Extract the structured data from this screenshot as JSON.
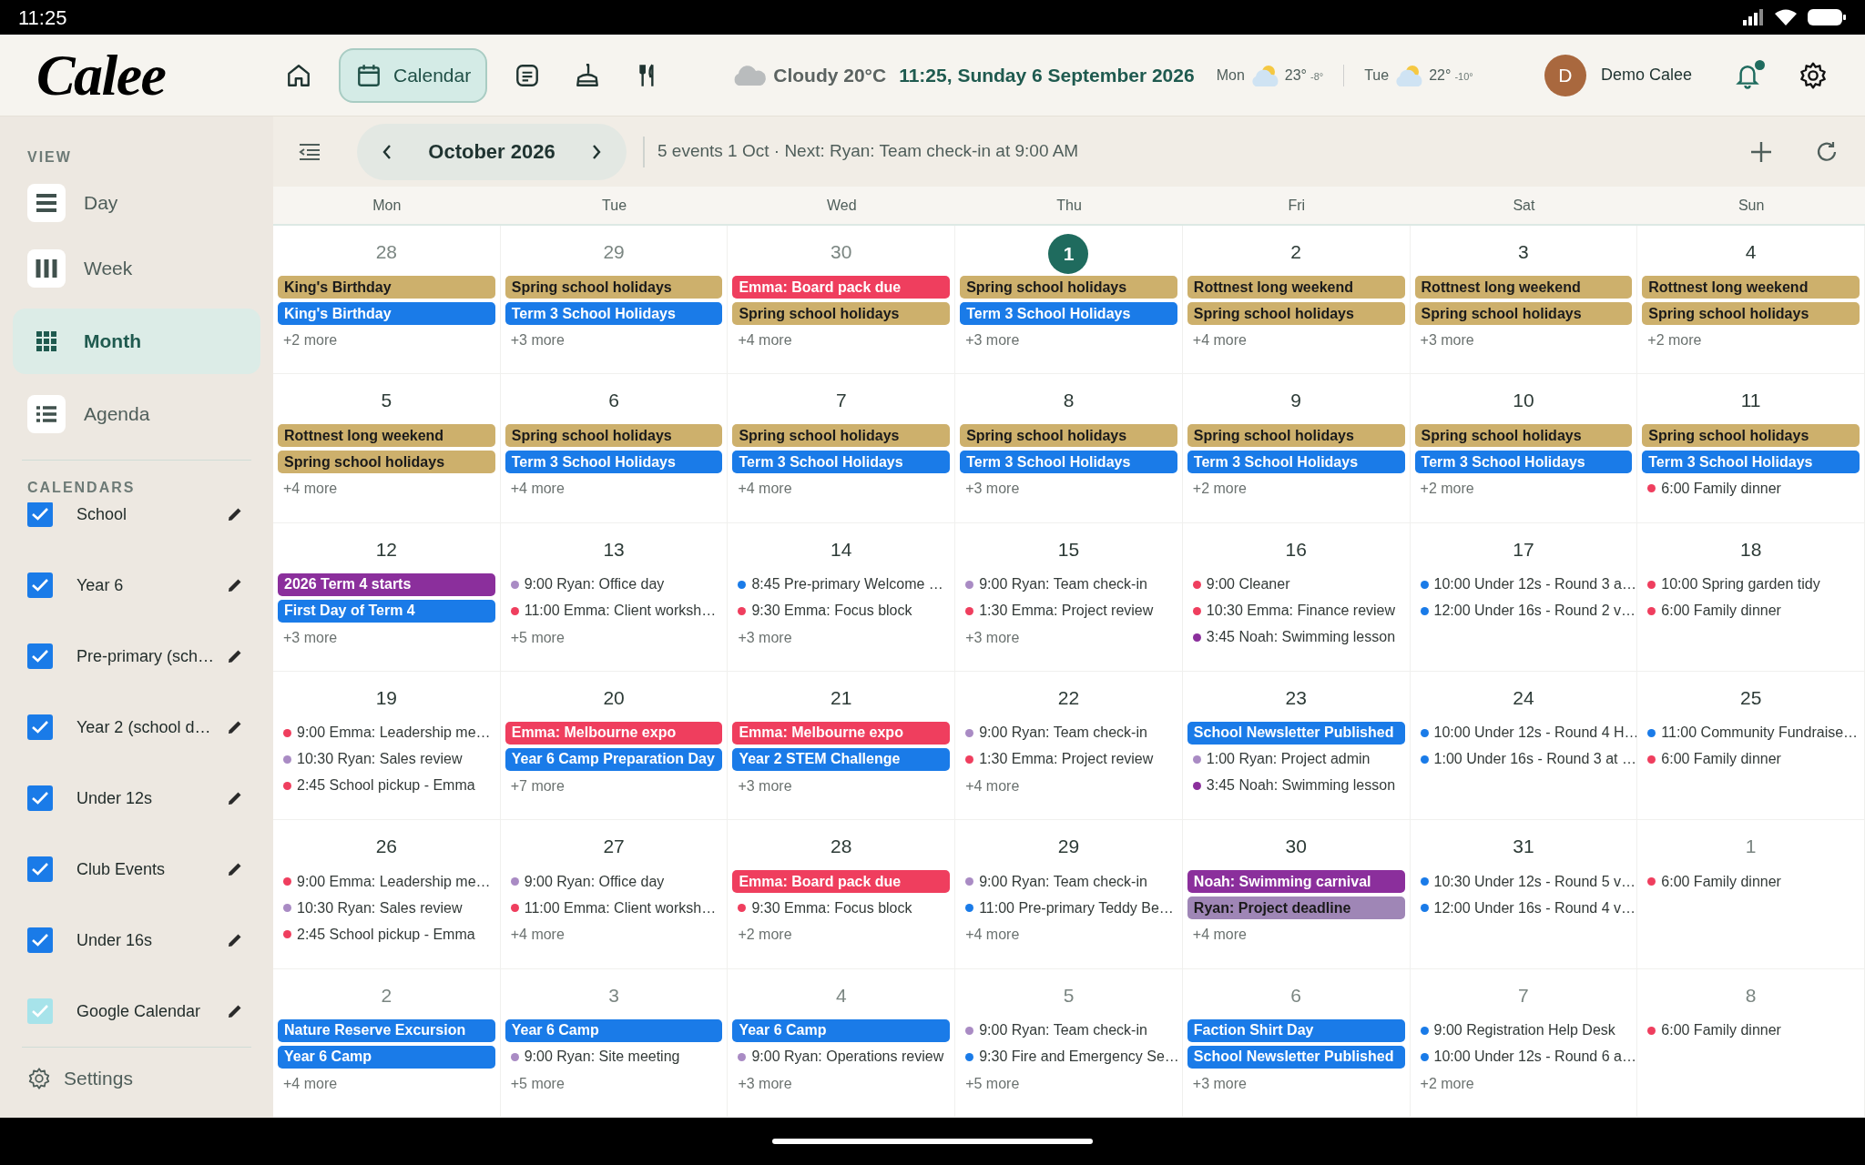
{
  "status_bar": {
    "time": "11:25"
  },
  "header": {
    "logo": "Calee",
    "nav": [
      {
        "selected": false
      },
      {
        "label": "Calendar",
        "selected": true
      },
      {
        "selected": false
      },
      {
        "selected": false
      },
      {
        "selected": false
      }
    ],
    "weather": {
      "now": "Cloudy 20°C",
      "datetime": "11:25, Sunday 6 September 2026",
      "forecast": [
        {
          "day": "Mon",
          "high": "23°",
          "low": "-8°"
        },
        {
          "day": "Tue",
          "high": "22°",
          "low": "-10°"
        }
      ]
    },
    "user": {
      "initial": "D",
      "name": "Demo Calee"
    },
    "notifications_unread": true
  },
  "sidebar": {
    "view_heading": "VIEW",
    "views": [
      {
        "label": "Day",
        "selected": false
      },
      {
        "label": "Week",
        "selected": false
      },
      {
        "label": "Month",
        "selected": true
      },
      {
        "label": "Agenda",
        "selected": false
      }
    ],
    "calendars_heading": "CALENDARS",
    "calendars": [
      {
        "label": "School",
        "checked": true,
        "color": "#1a7be8"
      },
      {
        "label": "Year 6",
        "checked": true,
        "color": "#1a7be8"
      },
      {
        "label": "Pre-primary (sch…",
        "checked": true,
        "color": "#1a7be8"
      },
      {
        "label": "Year 2 (school d…",
        "checked": true,
        "color": "#1a7be8"
      },
      {
        "label": "Under 12s",
        "checked": true,
        "color": "#1a7be8"
      },
      {
        "label": "Club Events",
        "checked": true,
        "color": "#1a7be8"
      },
      {
        "label": "Under 16s",
        "checked": true,
        "color": "#1a7be8"
      },
      {
        "label": "Google Calendar",
        "checked": true,
        "color": "#a7e3ea"
      }
    ],
    "settings": "Settings"
  },
  "toolbar": {
    "month": "October 2026",
    "summary": "5 events 1 Oct · Next: Ryan: Team check-in at 9:00 AM"
  },
  "weekdays": [
    "Mon",
    "Tue",
    "Wed",
    "Thu",
    "Fri",
    "Sat",
    "Sun"
  ],
  "weeks": [
    [
      {
        "day": "28",
        "in_month": false,
        "today": false,
        "events": [
          {
            "kind": "bar",
            "title": "King's Birthday",
            "color": "#cdb06c"
          },
          {
            "kind": "bar",
            "title": "King's Birthday",
            "color": "#1a7be8"
          }
        ],
        "more": "+2 more"
      },
      {
        "day": "29",
        "in_month": false,
        "today": false,
        "events": [
          {
            "kind": "bar",
            "title": "Spring school holidays",
            "color": "#cdb06c"
          },
          {
            "kind": "bar",
            "title": "Term 3 School Holidays",
            "color": "#1a7be8"
          }
        ],
        "more": "+3 more"
      },
      {
        "day": "30",
        "in_month": false,
        "today": false,
        "events": [
          {
            "kind": "bar",
            "title": "Emma: Board pack due",
            "color": "#ef3e5e"
          },
          {
            "kind": "bar",
            "title": "Spring school holidays",
            "color": "#cdb06c"
          }
        ],
        "more": "+4 more"
      },
      {
        "day": "1",
        "in_month": true,
        "today": true,
        "events": [
          {
            "kind": "bar",
            "title": "Spring school holidays",
            "color": "#cdb06c"
          },
          {
            "kind": "bar",
            "title": "Term 3 School Holidays",
            "color": "#1a7be8"
          }
        ],
        "more": "+3 more"
      },
      {
        "day": "2",
        "in_month": true,
        "today": false,
        "events": [
          {
            "kind": "bar",
            "title": "Rottnest long weekend",
            "color": "#cdb06c"
          },
          {
            "kind": "bar",
            "title": "Spring school holidays",
            "color": "#cdb06c"
          }
        ],
        "more": "+4 more"
      },
      {
        "day": "3",
        "in_month": true,
        "today": false,
        "events": [
          {
            "kind": "bar",
            "title": "Rottnest long weekend",
            "color": "#cdb06c"
          },
          {
            "kind": "bar",
            "title": "Spring school holidays",
            "color": "#cdb06c"
          }
        ],
        "more": "+3 more"
      },
      {
        "day": "4",
        "in_month": true,
        "today": false,
        "events": [
          {
            "kind": "bar",
            "title": "Rottnest long weekend",
            "color": "#cdb06c"
          },
          {
            "kind": "bar",
            "title": "Spring school holidays",
            "color": "#cdb06c"
          }
        ],
        "more": "+2 more"
      }
    ],
    [
      {
        "day": "5",
        "in_month": true,
        "today": false,
        "events": [
          {
            "kind": "bar",
            "title": "Rottnest long weekend",
            "color": "#cdb06c"
          },
          {
            "kind": "bar",
            "title": "Spring school holidays",
            "color": "#cdb06c"
          }
        ],
        "more": "+4 more"
      },
      {
        "day": "6",
        "in_month": true,
        "today": false,
        "events": [
          {
            "kind": "bar",
            "title": "Spring school holidays",
            "color": "#cdb06c"
          },
          {
            "kind": "bar",
            "title": "Term 3 School Holidays",
            "color": "#1a7be8"
          }
        ],
        "more": "+4 more"
      },
      {
        "day": "7",
        "in_month": true,
        "today": false,
        "events": [
          {
            "kind": "bar",
            "title": "Spring school holidays",
            "color": "#cdb06c"
          },
          {
            "kind": "bar",
            "title": "Term 3 School Holidays",
            "color": "#1a7be8"
          }
        ],
        "more": "+4 more"
      },
      {
        "day": "8",
        "in_month": true,
        "today": false,
        "events": [
          {
            "kind": "bar",
            "title": "Spring school holidays",
            "color": "#cdb06c"
          },
          {
            "kind": "bar",
            "title": "Term 3 School Holidays",
            "color": "#1a7be8"
          }
        ],
        "more": "+3 more"
      },
      {
        "day": "9",
        "in_month": true,
        "today": false,
        "events": [
          {
            "kind": "bar",
            "title": "Spring school holidays",
            "color": "#cdb06c"
          },
          {
            "kind": "bar",
            "title": "Term 3 School Holidays",
            "color": "#1a7be8"
          }
        ],
        "more": "+2 more"
      },
      {
        "day": "10",
        "in_month": true,
        "today": false,
        "events": [
          {
            "kind": "bar",
            "title": "Spring school holidays",
            "color": "#cdb06c"
          },
          {
            "kind": "bar",
            "title": "Term 3 School Holidays",
            "color": "#1a7be8"
          }
        ],
        "more": "+2 more"
      },
      {
        "day": "11",
        "in_month": true,
        "today": false,
        "events": [
          {
            "kind": "bar",
            "title": "Spring school holidays",
            "color": "#cdb06c"
          },
          {
            "kind": "bar",
            "title": "Term 3 School Holidays",
            "color": "#1a7be8"
          },
          {
            "kind": "dot",
            "title": "6:00 Family dinner",
            "color": "#ef3e5e"
          }
        ]
      }
    ],
    [
      {
        "day": "12",
        "in_month": true,
        "today": false,
        "events": [
          {
            "kind": "bar",
            "title": "2026 Term 4 starts",
            "color": "#8b2f9c"
          },
          {
            "kind": "bar",
            "title": "First Day of Term 4",
            "color": "#1a7be8"
          }
        ],
        "more": "+3 more"
      },
      {
        "day": "13",
        "in_month": true,
        "today": false,
        "events": [
          {
            "kind": "dot",
            "title": "9:00 Ryan: Office day",
            "color": "#a98bc4"
          },
          {
            "kind": "dot",
            "title": "11:00 Emma: Client worksh…",
            "color": "#ef3e5e"
          }
        ],
        "more": "+5 more"
      },
      {
        "day": "14",
        "in_month": true,
        "today": false,
        "events": [
          {
            "kind": "dot",
            "title": "8:45 Pre-primary Welcome …",
            "color": "#1a7be8"
          },
          {
            "kind": "dot",
            "title": "9:30 Emma: Focus block",
            "color": "#ef3e5e"
          }
        ],
        "more": "+3 more"
      },
      {
        "day": "15",
        "in_month": true,
        "today": false,
        "events": [
          {
            "kind": "dot",
            "title": "9:00 Ryan: Team check-in",
            "color": "#a98bc4"
          },
          {
            "kind": "dot",
            "title": "1:30 Emma: Project review",
            "color": "#ef3e5e"
          }
        ],
        "more": "+3 more"
      },
      {
        "day": "16",
        "in_month": true,
        "today": false,
        "events": [
          {
            "kind": "dot",
            "title": "9:00 Cleaner",
            "color": "#ef3e5e"
          },
          {
            "kind": "dot",
            "title": "10:30 Emma: Finance review",
            "color": "#ef3e5e"
          },
          {
            "kind": "dot",
            "title": "3:45 Noah: Swimming lesson",
            "color": "#8b2f9c"
          }
        ]
      },
      {
        "day": "17",
        "in_month": true,
        "today": false,
        "events": [
          {
            "kind": "dot",
            "title": "10:00 Under 12s - Round 3 a…",
            "color": "#1a7be8"
          },
          {
            "kind": "dot",
            "title": "12:00 Under 16s - Round 2 v…",
            "color": "#1a7be8"
          }
        ]
      },
      {
        "day": "18",
        "in_month": true,
        "today": false,
        "events": [
          {
            "kind": "dot",
            "title": "10:00 Spring garden tidy",
            "color": "#ef3e5e"
          },
          {
            "kind": "dot",
            "title": "6:00 Family dinner",
            "color": "#ef3e5e"
          }
        ]
      }
    ],
    [
      {
        "day": "19",
        "in_month": true,
        "today": false,
        "events": [
          {
            "kind": "dot",
            "title": "9:00 Emma: Leadership me…",
            "color": "#ef3e5e"
          },
          {
            "kind": "dot",
            "title": "10:30 Ryan: Sales review",
            "color": "#a98bc4"
          },
          {
            "kind": "dot",
            "title": "2:45 School pickup - Emma",
            "color": "#ef3e5e"
          }
        ]
      },
      {
        "day": "20",
        "in_month": true,
        "today": false,
        "events": [
          {
            "kind": "bar",
            "title": "Emma: Melbourne expo",
            "color": "#ef3e5e"
          },
          {
            "kind": "bar",
            "title": "Year 6 Camp Preparation Day",
            "color": "#1a7be8"
          }
        ],
        "more": "+7 more"
      },
      {
        "day": "21",
        "in_month": true,
        "today": false,
        "events": [
          {
            "kind": "bar",
            "title": "Emma: Melbourne expo",
            "color": "#ef3e5e"
          },
          {
            "kind": "bar",
            "title": "Year 2 STEM Challenge",
            "color": "#1a7be8"
          }
        ],
        "more": "+3 more"
      },
      {
        "day": "22",
        "in_month": true,
        "today": false,
        "events": [
          {
            "kind": "dot",
            "title": "9:00 Ryan: Team check-in",
            "color": "#a98bc4"
          },
          {
            "kind": "dot",
            "title": "1:30 Emma: Project review",
            "color": "#ef3e5e"
          }
        ],
        "more": "+4 more"
      },
      {
        "day": "23",
        "in_month": true,
        "today": false,
        "events": [
          {
            "kind": "bar",
            "title": "School Newsletter Published",
            "color": "#1a7be8"
          },
          {
            "kind": "dot",
            "title": "1:00 Ryan: Project admin",
            "color": "#a98bc4"
          },
          {
            "kind": "dot",
            "title": "3:45 Noah: Swimming lesson",
            "color": "#8b2f9c"
          }
        ]
      },
      {
        "day": "24",
        "in_month": true,
        "today": false,
        "events": [
          {
            "kind": "dot",
            "title": "10:00 Under 12s - Round 4 H…",
            "color": "#1a7be8"
          },
          {
            "kind": "dot",
            "title": "1:00 Under 16s - Round 3 at …",
            "color": "#1a7be8"
          }
        ]
      },
      {
        "day": "25",
        "in_month": true,
        "today": false,
        "events": [
          {
            "kind": "dot",
            "title": "11:00 Community Fundraise…",
            "color": "#1a7be8"
          },
          {
            "kind": "dot",
            "title": "6:00 Family dinner",
            "color": "#ef3e5e"
          }
        ]
      }
    ],
    [
      {
        "day": "26",
        "in_month": true,
        "today": false,
        "events": [
          {
            "kind": "dot",
            "title": "9:00 Emma: Leadership me…",
            "color": "#ef3e5e"
          },
          {
            "kind": "dot",
            "title": "10:30 Ryan: Sales review",
            "color": "#a98bc4"
          },
          {
            "kind": "dot",
            "title": "2:45 School pickup - Emma",
            "color": "#ef3e5e"
          }
        ]
      },
      {
        "day": "27",
        "in_month": true,
        "today": false,
        "events": [
          {
            "kind": "dot",
            "title": "9:00 Ryan: Office day",
            "color": "#a98bc4"
          },
          {
            "kind": "dot",
            "title": "11:00 Emma: Client worksh…",
            "color": "#ef3e5e"
          }
        ],
        "more": "+4 more"
      },
      {
        "day": "28",
        "in_month": true,
        "today": false,
        "events": [
          {
            "kind": "bar",
            "title": "Emma: Board pack due",
            "color": "#ef3e5e"
          },
          {
            "kind": "dot",
            "title": "9:30 Emma: Focus block",
            "color": "#ef3e5e"
          }
        ],
        "more": "+2 more"
      },
      {
        "day": "29",
        "in_month": true,
        "today": false,
        "events": [
          {
            "kind": "dot",
            "title": "9:00 Ryan: Team check-in",
            "color": "#a98bc4"
          },
          {
            "kind": "dot",
            "title": "11:00 Pre-primary Teddy Be…",
            "color": "#1a7be8"
          }
        ],
        "more": "+4 more"
      },
      {
        "day": "30",
        "in_month": true,
        "today": false,
        "events": [
          {
            "kind": "bar",
            "title": "Noah: Swimming carnival",
            "color": "#8b2f9c"
          },
          {
            "kind": "bar",
            "title": "Ryan: Project deadline",
            "color": "#9f86b6"
          }
        ],
        "more": "+4 more"
      },
      {
        "day": "31",
        "in_month": true,
        "today": false,
        "events": [
          {
            "kind": "dot",
            "title": "10:30 Under 12s - Round 5 v…",
            "color": "#1a7be8"
          },
          {
            "kind": "dot",
            "title": "12:00 Under 16s - Round 4 v…",
            "color": "#1a7be8"
          }
        ]
      },
      {
        "day": "1",
        "in_month": false,
        "today": false,
        "events": [
          {
            "kind": "dot",
            "title": "6:00 Family dinner",
            "color": "#ef3e5e"
          }
        ]
      }
    ],
    [
      {
        "day": "2",
        "in_month": false,
        "today": false,
        "events": [
          {
            "kind": "bar",
            "title": "Nature Reserve Excursion",
            "color": "#1a7be8"
          },
          {
            "kind": "bar",
            "title": "Year 6 Camp",
            "color": "#1a7be8"
          }
        ],
        "more": "+4 more"
      },
      {
        "day": "3",
        "in_month": false,
        "today": false,
        "events": [
          {
            "kind": "bar",
            "title": "Year 6 Camp",
            "color": "#1a7be8"
          },
          {
            "kind": "dot",
            "title": "9:00 Ryan: Site meeting",
            "color": "#a98bc4"
          }
        ],
        "more": "+5 more"
      },
      {
        "day": "4",
        "in_month": false,
        "today": false,
        "events": [
          {
            "kind": "bar",
            "title": "Year 6 Camp",
            "color": "#1a7be8"
          },
          {
            "kind": "dot",
            "title": "9:00 Ryan: Operations review",
            "color": "#a98bc4"
          }
        ],
        "more": "+3 more"
      },
      {
        "day": "5",
        "in_month": false,
        "today": false,
        "events": [
          {
            "kind": "dot",
            "title": "9:00 Ryan: Team check-in",
            "color": "#a98bc4"
          },
          {
            "kind": "dot",
            "title": "9:30 Fire and Emergency Se…",
            "color": "#1a7be8"
          }
        ],
        "more": "+5 more"
      },
      {
        "day": "6",
        "in_month": false,
        "today": false,
        "events": [
          {
            "kind": "bar",
            "title": "Faction Shirt Day",
            "color": "#1a7be8"
          },
          {
            "kind": "bar",
            "title": "School Newsletter Published",
            "color": "#1a7be8"
          }
        ],
        "more": "+3 more"
      },
      {
        "day": "7",
        "in_month": false,
        "today": false,
        "events": [
          {
            "kind": "dot",
            "title": "9:00 Registration Help Desk",
            "color": "#1a7be8"
          },
          {
            "kind": "dot",
            "title": "10:00 Under 12s - Round 6 a…",
            "color": "#1a7be8"
          }
        ],
        "more": "+2 more"
      },
      {
        "day": "8",
        "in_month": false,
        "today": false,
        "events": [
          {
            "kind": "dot",
            "title": "6:00 Family dinner",
            "color": "#ef3e5e"
          }
        ]
      }
    ]
  ]
}
